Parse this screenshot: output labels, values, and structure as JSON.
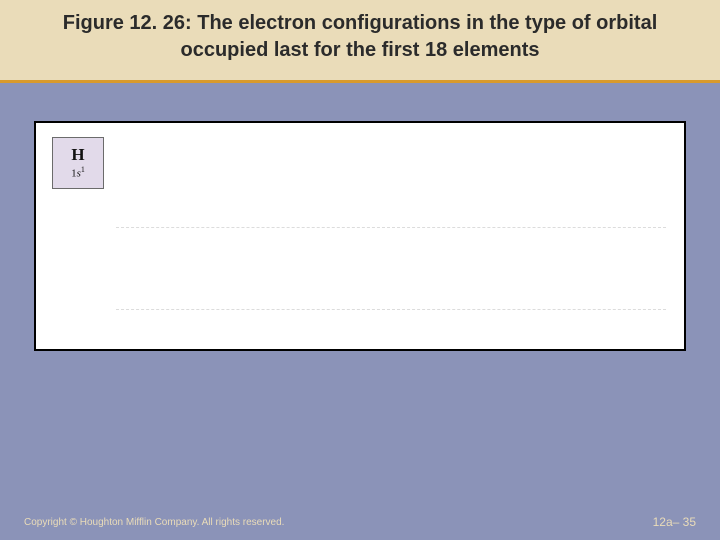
{
  "title": "Figure 12. 26:  The electron configurations in the type of orbital occupied last for the first 18 elements",
  "element": {
    "symbol": "H",
    "config_prefix": "1",
    "config_orbital": "s",
    "config_super": "1"
  },
  "footer": {
    "copyright": "Copyright © Houghton Mifflin Company. All rights reserved.",
    "slide_number": "12a– 35"
  }
}
